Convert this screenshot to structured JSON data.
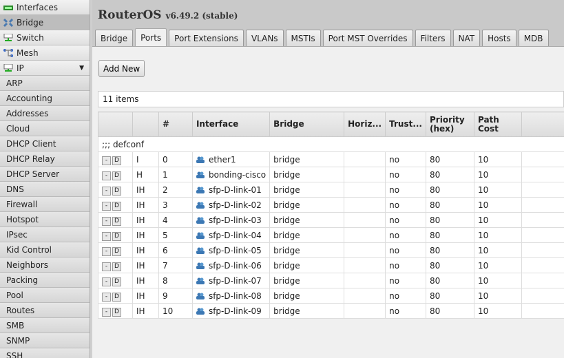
{
  "sidebar": {
    "top": [
      {
        "label": "Interfaces",
        "icon": "interfaces-icon"
      },
      {
        "label": "Bridge",
        "icon": "bridge-icon",
        "selected": true
      },
      {
        "label": "Switch",
        "icon": "switch-icon"
      },
      {
        "label": "Mesh",
        "icon": "mesh-icon"
      },
      {
        "label": "IP",
        "icon": "ip-icon"
      }
    ],
    "sub": [
      "ARP",
      "Accounting",
      "Addresses",
      "Cloud",
      "DHCP Client",
      "DHCP Relay",
      "DHCP Server",
      "DNS",
      "Firewall",
      "Hotspot",
      "IPsec",
      "Kid Control",
      "Neighbors",
      "Packing",
      "Pool",
      "Routes",
      "SMB",
      "SNMP",
      "SSH"
    ]
  },
  "header": {
    "title": "RouterOS",
    "version": "v6.49.2 (stable)"
  },
  "tabs": [
    "Bridge",
    "Ports",
    "Port Extensions",
    "VLANs",
    "MSTIs",
    "Port MST Overrides",
    "Filters",
    "NAT",
    "Hosts",
    "MDB"
  ],
  "active_tab": "Ports",
  "add_new": "Add New",
  "item_count": "11 items",
  "table": {
    "columns": [
      "",
      "",
      "#",
      "Interface",
      "Bridge",
      "Horiz...",
      "Trust...",
      "Priority (hex)",
      "Path Cost",
      ""
    ],
    "comment": ";;; defconf",
    "rows": [
      [
        "I",
        "0",
        "ether1",
        "bridge",
        "",
        "no",
        "80",
        "10"
      ],
      [
        "H",
        "1",
        "bonding-cisco",
        "bridge",
        "",
        "no",
        "80",
        "10"
      ],
      [
        "IH",
        "2",
        "sfp-D-link-01",
        "bridge",
        "",
        "no",
        "80",
        "10"
      ],
      [
        "IH",
        "3",
        "sfp-D-link-02",
        "bridge",
        "",
        "no",
        "80",
        "10"
      ],
      [
        "IH",
        "4",
        "sfp-D-link-03",
        "bridge",
        "",
        "no",
        "80",
        "10"
      ],
      [
        "IH",
        "5",
        "sfp-D-link-04",
        "bridge",
        "",
        "no",
        "80",
        "10"
      ],
      [
        "IH",
        "6",
        "sfp-D-link-05",
        "bridge",
        "",
        "no",
        "80",
        "10"
      ],
      [
        "IH",
        "7",
        "sfp-D-link-06",
        "bridge",
        "",
        "no",
        "80",
        "10"
      ],
      [
        "IH",
        "8",
        "sfp-D-link-07",
        "bridge",
        "",
        "no",
        "80",
        "10"
      ],
      [
        "IH",
        "9",
        "sfp-D-link-08",
        "bridge",
        "",
        "no",
        "80",
        "10"
      ],
      [
        "IH",
        "10",
        "sfp-D-link-09",
        "bridge",
        "",
        "no",
        "80",
        "10"
      ]
    ],
    "remove_label": "-",
    "disable_label": "D"
  }
}
